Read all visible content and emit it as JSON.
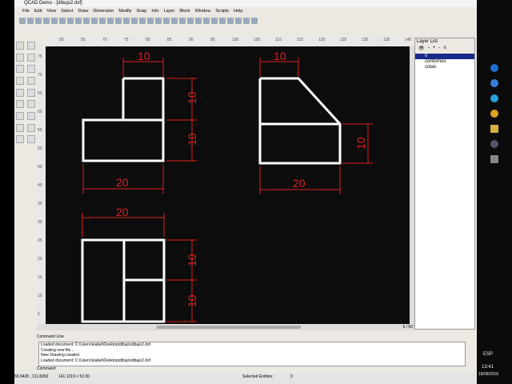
{
  "title": "QCAD Demo - [dibujo2.dxf]",
  "menu": [
    "File",
    "Edit",
    "View",
    "Select",
    "Draw",
    "Dimension",
    "Modify",
    "Snap",
    "Info",
    "Layer",
    "Block",
    "Window",
    "Scripts",
    "Help"
  ],
  "ruler_h": [
    "50",
    "55",
    "70",
    "75",
    "80",
    "85",
    "90",
    "95",
    "100",
    "105",
    "110",
    "115",
    "120",
    "125",
    "130",
    "135",
    "140"
  ],
  "ruler_v": [
    "75",
    "70",
    "65",
    "60",
    "55",
    "50",
    "45",
    "40",
    "35",
    "30",
    "25",
    "20",
    "15",
    "10",
    "5"
  ],
  "dimensions": {
    "a": "10",
    "b": "10",
    "c": "10",
    "d": "20",
    "e": "10",
    "f": "10",
    "g": "20",
    "h": "20",
    "i": "10",
    "j": "10"
  },
  "page_indicator": "5 / 50",
  "layer_list": {
    "title": "Layer List",
    "layers": [
      "0",
      "contornos",
      "cotas"
    ]
  },
  "command_line": {
    "title": "Command Line",
    "log": [
      "Loaded document: C:\\Users\\Isabel\\Desktop\\dibujo\\dibujo2.dxf",
      "Creating new file...",
      "New Drawing created.",
      "Loaded document: C:\\Users\\Isabel\\Desktop\\dibujo\\dibujo2.dxf"
    ],
    "prompt": "Command:"
  },
  "status": {
    "coords_abs": "69.9428 , 111.8269",
    "coords_rel": "141.1219 < 52.00",
    "selected": "Selected Entities:",
    "selected_count": "0"
  },
  "taskbar": {
    "lang": "ESP",
    "time": "13:41",
    "date": "18/09/2016"
  },
  "colors": {
    "dim": "#e02020",
    "geom": "#ffffff"
  }
}
